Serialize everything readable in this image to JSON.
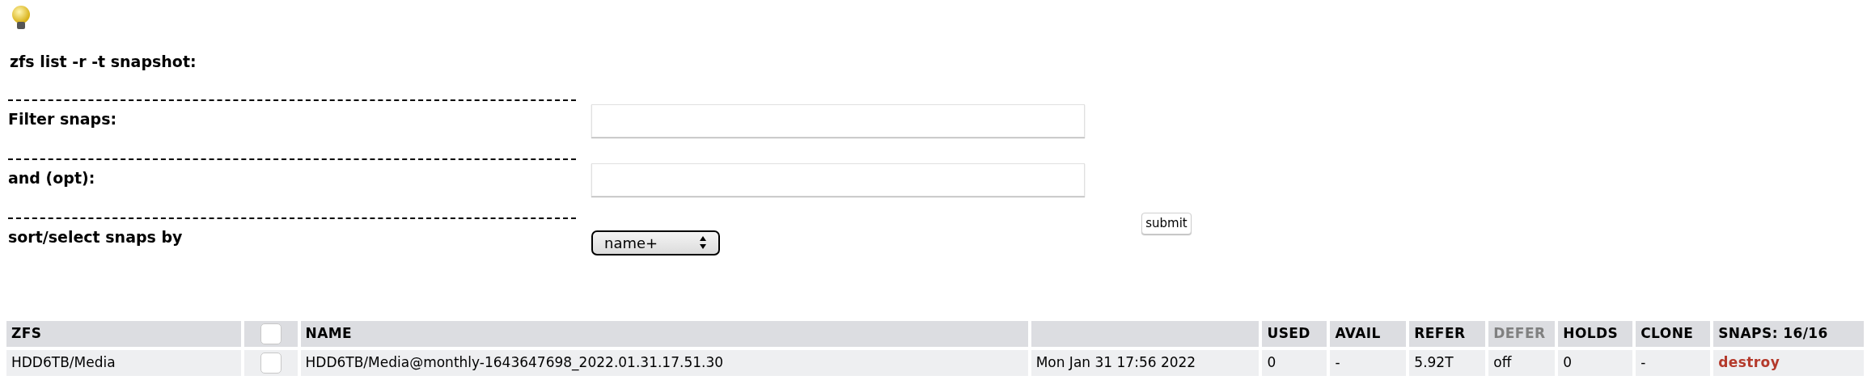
{
  "heading": "zfs list -r -t snapshot:",
  "fields": [
    {
      "kind": "text",
      "label": "Filter snaps:"
    },
    {
      "kind": "text",
      "label": "and (opt):"
    },
    {
      "kind": "select",
      "label": "sort/select snaps by",
      "value": "name+"
    }
  ],
  "submit": "submit",
  "table": {
    "columns": [
      {
        "kind": "text",
        "label": "ZFS",
        "disabled": false
      },
      {
        "kind": "checkbox",
        "checked": false
      },
      {
        "kind": "text",
        "label": "NAME",
        "disabled": false
      },
      {
        "kind": "blank"
      },
      {
        "kind": "text",
        "label": "USED",
        "disabled": false
      },
      {
        "kind": "text",
        "label": "AVAIL",
        "disabled": false
      },
      {
        "kind": "text",
        "label": "REFER",
        "disabled": false
      },
      {
        "kind": "text",
        "label": "DEFER",
        "disabled": true
      },
      {
        "kind": "text",
        "label": "HOLDS",
        "disabled": false
      },
      {
        "kind": "text",
        "label": "CLONE",
        "disabled": false
      },
      {
        "kind": "text",
        "label": "SNAPS: 16/16",
        "disabled": false
      }
    ],
    "rows": [
      {
        "cells": [
          {
            "kind": "text",
            "text": "HDD6TB/Media"
          },
          {
            "kind": "checkbox",
            "checked": false
          },
          {
            "kind": "text",
            "text": "HDD6TB/Media@monthly-1643647698_2022.01.31.17.51.30"
          },
          {
            "kind": "text",
            "text": "Mon Jan 31 17:56 2022"
          },
          {
            "kind": "text",
            "text": "0"
          },
          {
            "kind": "text",
            "text": "-"
          },
          {
            "kind": "text",
            "text": "5.92T"
          },
          {
            "kind": "text",
            "text": "off"
          },
          {
            "kind": "text",
            "text": "0"
          },
          {
            "kind": "text",
            "text": "-"
          },
          {
            "kind": "link",
            "text": "destroy"
          }
        ]
      }
    ]
  }
}
